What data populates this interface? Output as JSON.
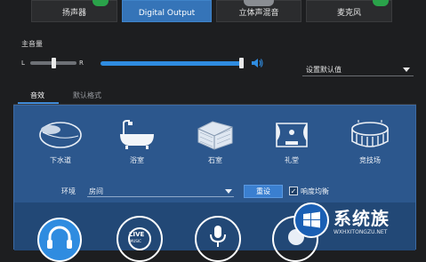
{
  "device_tabs": [
    {
      "label": "扬声器",
      "active": false,
      "icon": "green-check-icon"
    },
    {
      "label": "Digital Output",
      "active": true,
      "icon": ""
    },
    {
      "label": "立体声混音",
      "active": false,
      "icon": "gray-device-icon"
    },
    {
      "label": "麦克风",
      "active": false,
      "icon": "green-check-icon"
    }
  ],
  "master_volume": {
    "title": "主音量",
    "left_label": "L",
    "right_label": "R",
    "balance_fraction": 0.5,
    "volume_fraction": 1.0
  },
  "default_dropdown": {
    "value": "设置默认值"
  },
  "sub_tabs": [
    {
      "label": "音效",
      "active": true
    },
    {
      "label": "默认格式",
      "active": false
    }
  ],
  "environments": [
    {
      "label": "下水道",
      "icon": "pipe-icon"
    },
    {
      "label": "浴室",
      "icon": "bathtub-icon"
    },
    {
      "label": "石室",
      "icon": "stone-room-icon"
    },
    {
      "label": "礼堂",
      "icon": "auditorium-icon"
    },
    {
      "label": "竞技场",
      "icon": "stadium-icon"
    }
  ],
  "environment_row": {
    "label": "环境",
    "value": "房间",
    "reset_label": "重设",
    "loudness_label": "响度均衡",
    "loudness_checked": true
  },
  "bottom_icons": [
    "headphones-icon",
    "live-music-icon",
    "microphone-icon",
    "other-effect-icon"
  ],
  "bottom_icon_labels": {
    "live": "LIVE",
    "music": "MUSIC"
  },
  "watermark": {
    "text": "系统族",
    "url": "WXHXITONGZU.NET"
  },
  "colors": {
    "accent": "#3574b8",
    "panel": "#2c578d",
    "volume": "#2f8ce0",
    "check": "#2aa34a"
  }
}
